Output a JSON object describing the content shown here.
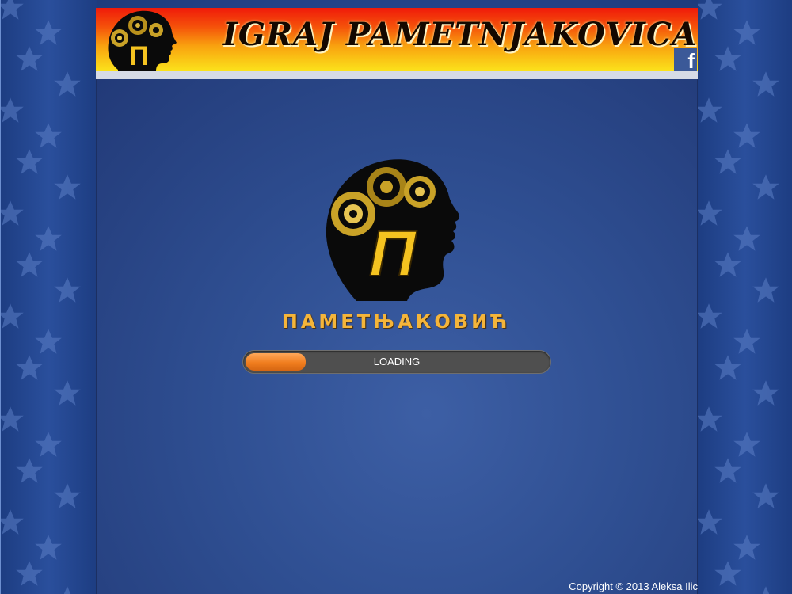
{
  "header": {
    "title": "IGRAJ PAMETNJAKOVICA",
    "facebook_label": "f",
    "logo_letter": "П"
  },
  "loader": {
    "brand_name": "ПАМЕТЊАКОВИЋ",
    "logo_letter": "П",
    "progress_label": "LOADING",
    "progress_fraction": 0.2
  },
  "footer": {
    "copyright": "Copyright © 2013 Aleksa Ilic"
  },
  "colors": {
    "accent": "#f5b53a",
    "progress_fill": "#f07d1e",
    "facebook": "#3b5998"
  },
  "icons": [
    "star-pattern",
    "gear-head-logo",
    "facebook-icon"
  ]
}
